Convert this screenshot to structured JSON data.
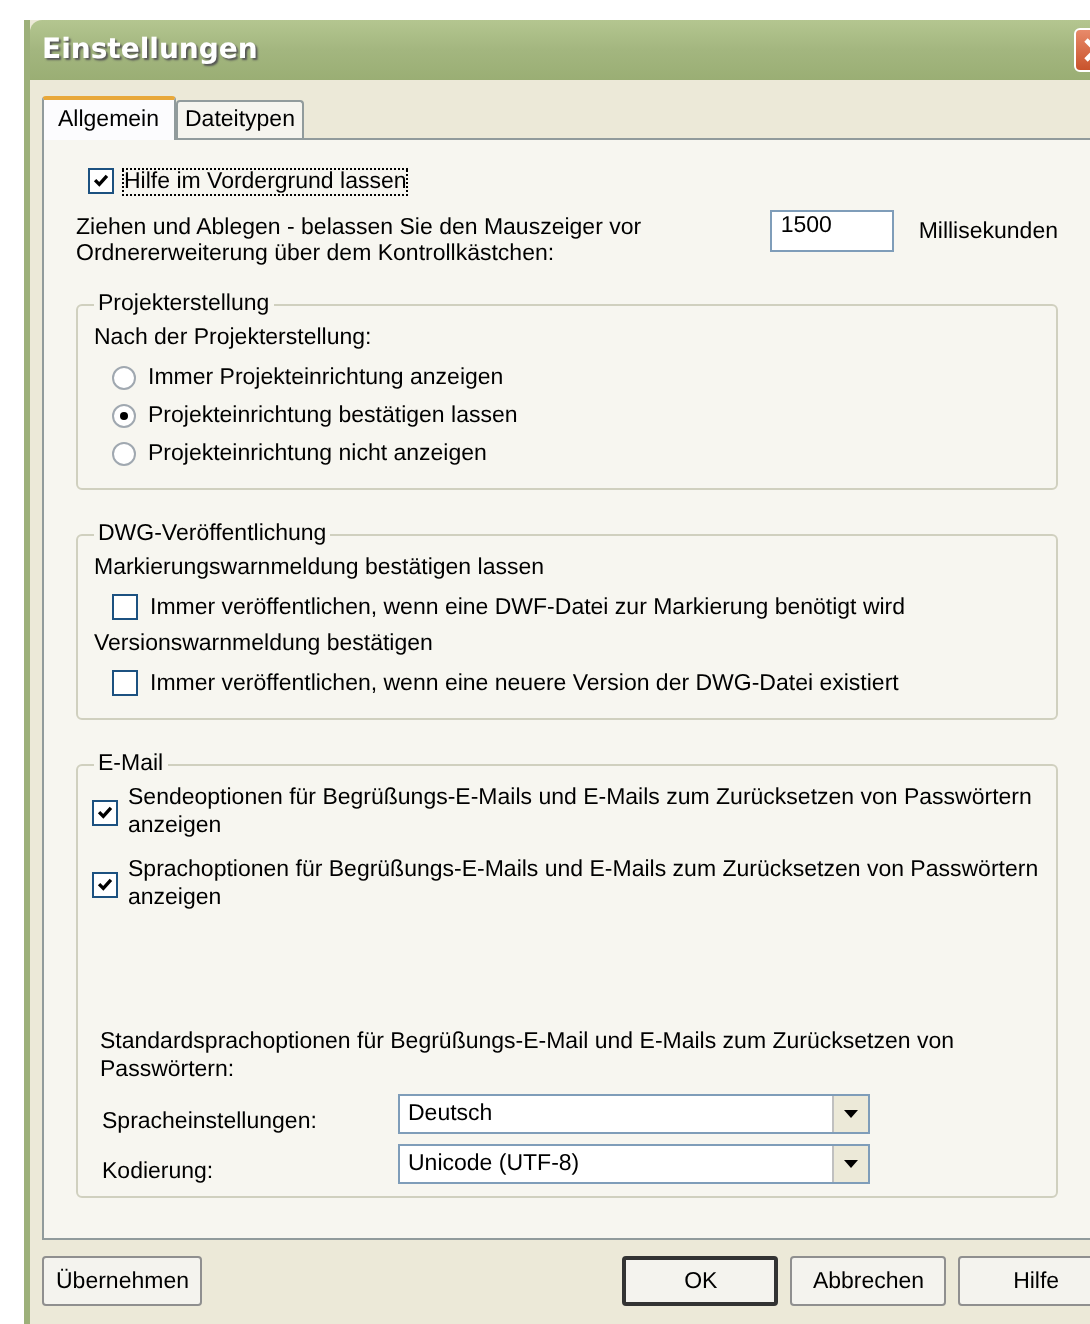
{
  "window": {
    "title": "Einstellungen"
  },
  "tabs": [
    {
      "label": "Allgemein",
      "selected": true
    },
    {
      "label": "Dateitypen",
      "selected": false
    }
  ],
  "keep_help_on_top": {
    "label": "Hilfe im Vordergrund lassen",
    "checked": true,
    "focused": true
  },
  "drag_delay": {
    "label": "Ziehen und Ablegen - belassen Sie den Mauszeiger vor Ordnererweiterung über dem Kontrollkästchen:",
    "value": "1500",
    "unit": "Millisekunden"
  },
  "project_creation": {
    "title": "Projekterstellung",
    "prompt": "Nach der Projekterstellung:",
    "options": [
      {
        "label": "Immer Projekteinrichtung anzeigen",
        "selected": false
      },
      {
        "label": "Projekteinrichtung bestätigen lassen",
        "selected": true
      },
      {
        "label": "Projekteinrichtung nicht anzeigen",
        "selected": false
      }
    ]
  },
  "dwg_publishing": {
    "title": "DWG-Veröffentlichung",
    "items": [
      {
        "kind": "heading",
        "label": "Markierungswarnmeldung bestätigen lassen"
      },
      {
        "kind": "checkbox",
        "label": "Immer veröffentlichen, wenn eine DWF-Datei zur Markierung benötigt wird",
        "checked": false
      },
      {
        "kind": "heading",
        "label": "Versionswarnmeldung bestätigen"
      },
      {
        "kind": "checkbox",
        "label": "Immer veröffentlichen, wenn eine neuere Version der DWG-Datei existiert",
        "checked": false
      }
    ]
  },
  "email": {
    "title": "E-Mail",
    "options": [
      {
        "label": "Sendeoptionen für Begrüßungs-E-Mails und E-Mails zum Zurücksetzen von Passwörtern anzeigen",
        "checked": true
      },
      {
        "label": "Sprachoptionen für Begrüßungs-E-Mails und E-Mails zum Zurücksetzen von Passwörtern anzeigen",
        "checked": true
      }
    ],
    "note": "Standardsprachoptionen für Begrüßungs-E-Mail und E-Mails zum Zurücksetzen von Passwörtern:",
    "fields": [
      {
        "label": "Spracheinstellungen:",
        "value": "Deutsch"
      },
      {
        "label": "Kodierung:",
        "value": "Unicode (UTF-8)"
      }
    ]
  },
  "buttons": [
    {
      "label": "Übernehmen",
      "default": false
    },
    {
      "label": "OK",
      "default": true
    },
    {
      "label": "Abbrechen",
      "default": false
    },
    {
      "label": "Hilfe",
      "default": false
    }
  ]
}
